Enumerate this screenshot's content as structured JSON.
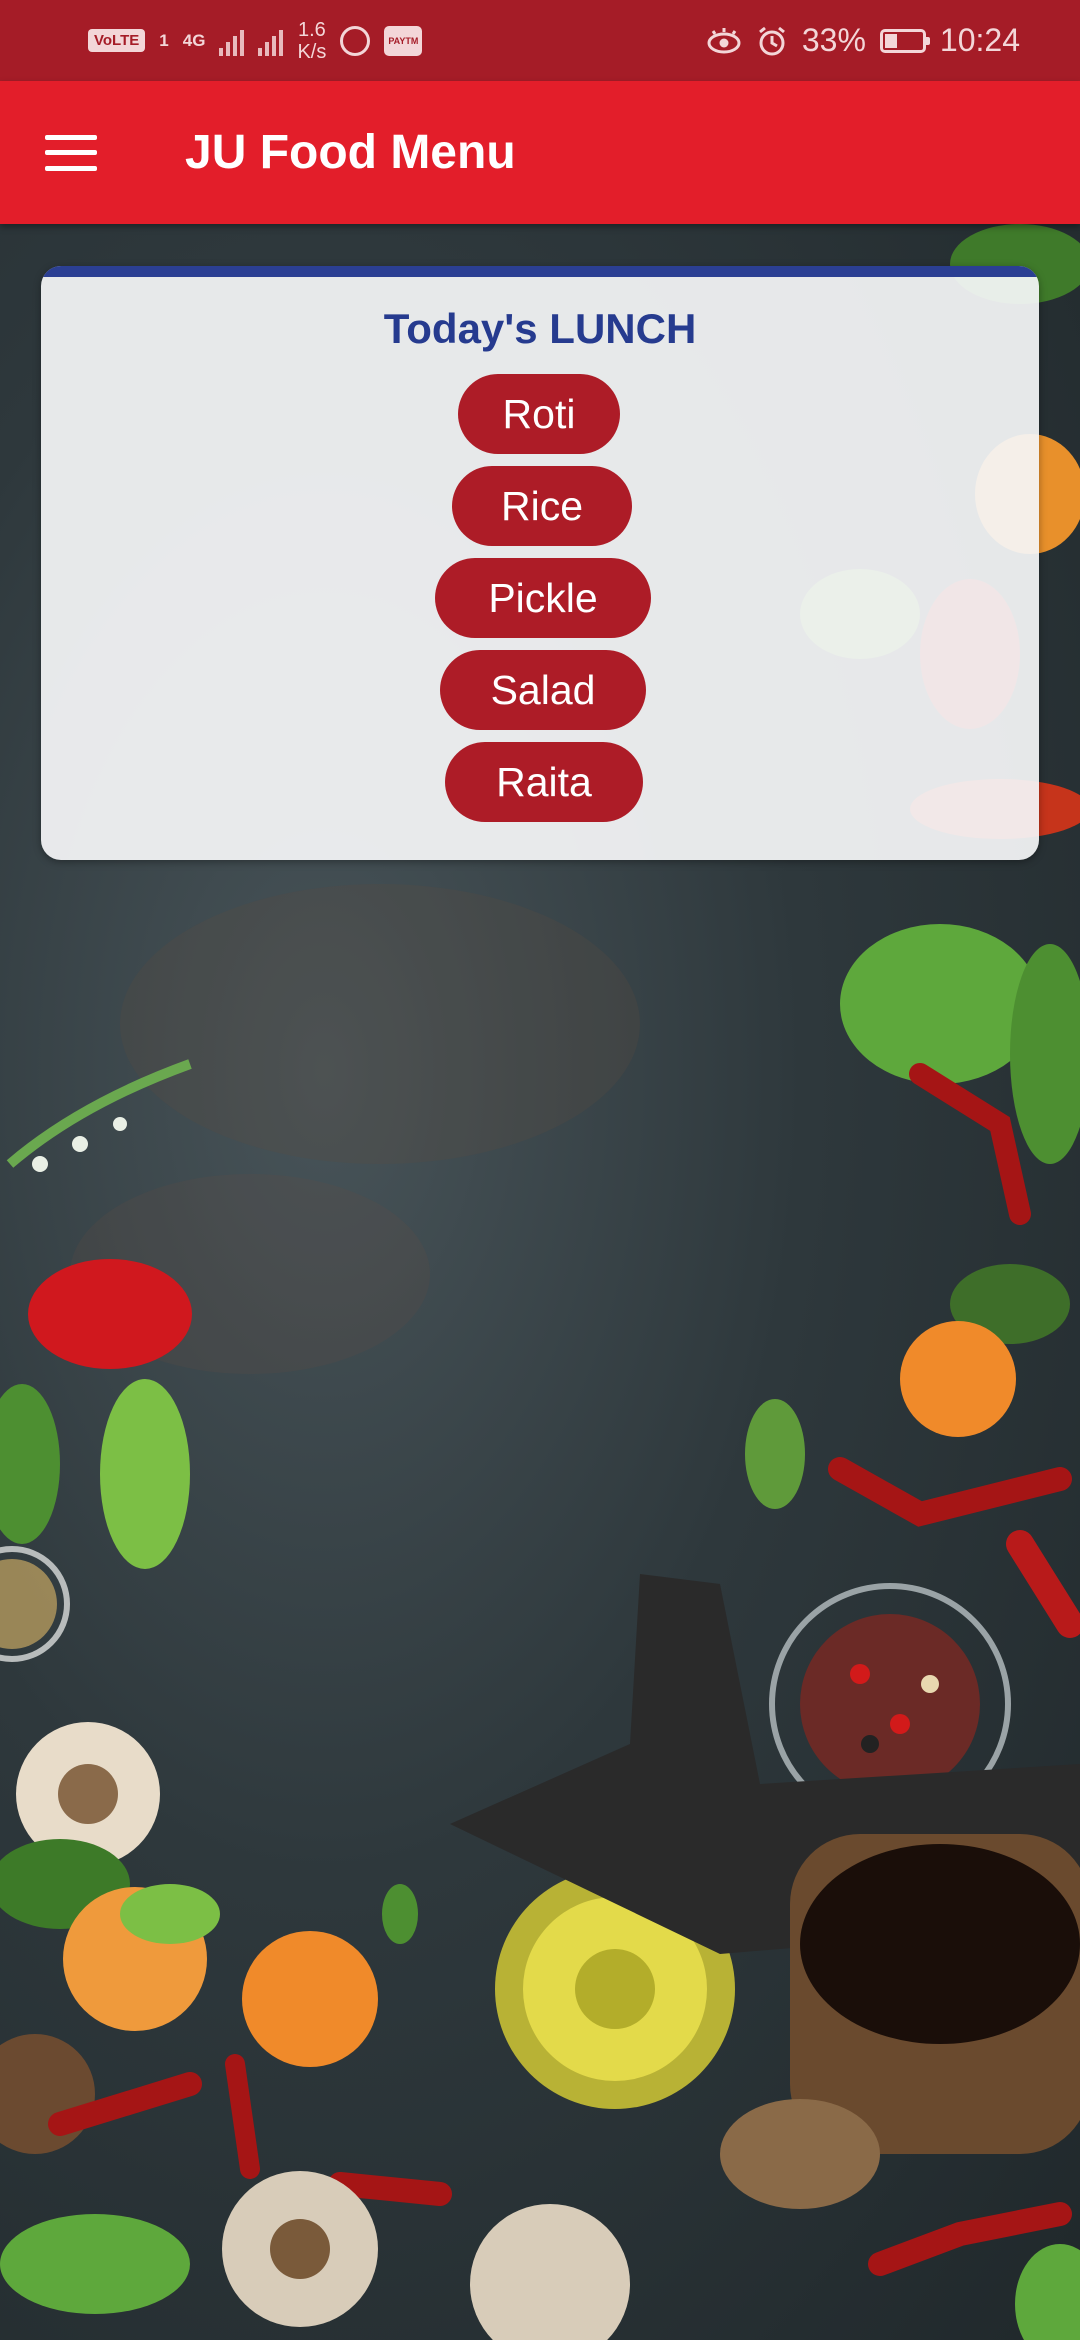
{
  "status_bar": {
    "volte_label": "VoLTE",
    "sim_label": "1",
    "network_label": "4G",
    "speed_value": "1.6",
    "speed_unit": "K/s",
    "paytm_label": "PAYTM",
    "battery": "33%",
    "time": "10:24"
  },
  "app_bar": {
    "title": "JU Food Menu",
    "menu_icon": "hamburger-menu-icon"
  },
  "menu_card": {
    "title": "Today's LUNCH",
    "accent_color": "#2b3f93",
    "item_color": "#ad1c27",
    "items": [
      {
        "label": "Roti"
      },
      {
        "label": "Rice"
      },
      {
        "label": "Pickle"
      },
      {
        "label": "Salad"
      },
      {
        "label": "Raita"
      }
    ]
  },
  "colors": {
    "status_bar": "#a51c27",
    "app_bar": "#e31e2a"
  }
}
